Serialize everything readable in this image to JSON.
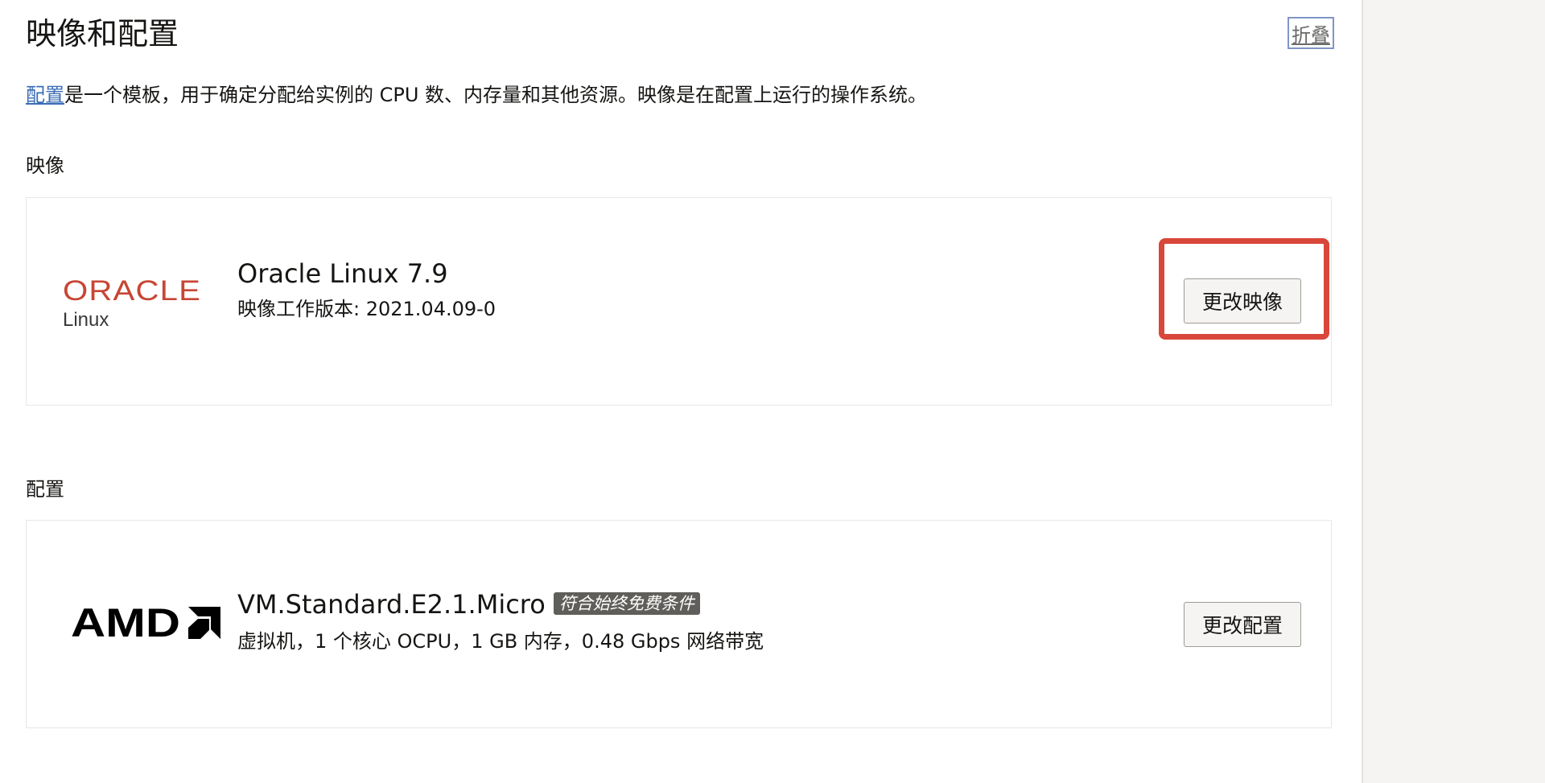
{
  "header": {
    "title": "映像和配置",
    "collapse_label": "折叠"
  },
  "description": {
    "link_text": "配置",
    "text": "是一个模板，用于确定分配给实例的 CPU 数、内存量和其他资源。映像是在配置上运行的操作系统。"
  },
  "image_section": {
    "heading": "映像",
    "logo_brand": "ORACLE",
    "logo_sub": "Linux",
    "title": "Oracle Linux 7.9",
    "subtitle": "映像工作版本: 2021.04.09-0",
    "button_label": "更改映像",
    "highlight_color": "#d9473a"
  },
  "shape_section": {
    "heading": "配置",
    "logo_brand": "AMD",
    "title": "VM.Standard.E2.1.Micro",
    "badge": "符合始终免费条件",
    "subtitle": "虚拟机，1 个核心 OCPU，1 GB 内存，0.48 Gbps 网络带宽",
    "button_label": "更改配置"
  },
  "colors": {
    "oracle_red": "#c74634",
    "link_blue": "#3b6db4",
    "badge_bg": "#5f5e5b"
  }
}
